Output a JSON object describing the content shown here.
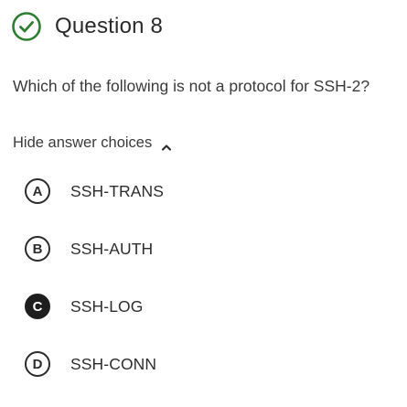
{
  "question": {
    "title": "Question 8",
    "status_icon": "check-circle-icon",
    "status_color": "#2e7d32",
    "text": "Which of the following is not a protocol for SSH-2?"
  },
  "answers_toggle": {
    "label": "Hide answer choices",
    "icon": "chevron-up-icon"
  },
  "choices": [
    {
      "letter": "A",
      "label": "SSH-TRANS",
      "selected": false
    },
    {
      "letter": "B",
      "label": "SSH-AUTH",
      "selected": false
    },
    {
      "letter": "C",
      "label": "SSH-LOG",
      "selected": true
    },
    {
      "letter": "D",
      "label": "SSH-CONN",
      "selected": false
    }
  ]
}
